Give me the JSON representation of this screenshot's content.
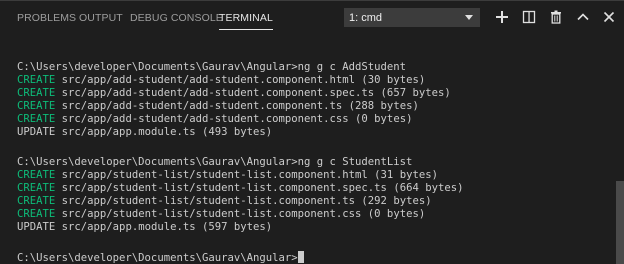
{
  "tabs": {
    "problems": "PROBLEMS",
    "output": "OUTPUT",
    "debug_console": "DEBUG CONSOLE",
    "terminal": "TERMINAL",
    "active": "TERMINAL"
  },
  "terminal_selector": {
    "selected": "1: cmd"
  },
  "actions": [
    {
      "name": "new-terminal",
      "icon": "plus-icon"
    },
    {
      "name": "split-terminal",
      "icon": "split-icon"
    },
    {
      "name": "kill-terminal",
      "icon": "trash-icon"
    },
    {
      "name": "maximize-panel",
      "icon": "chevron-up-icon"
    },
    {
      "name": "close-panel",
      "icon": "close-icon"
    }
  ],
  "terminal": {
    "lines": [
      {
        "prefix": "",
        "text": "C:\\Users\\developer\\Documents\\Gaurav\\Angular>ng g c AddStudent"
      },
      {
        "prefix": "CREATE",
        "text": " src/app/add-student/add-student.component.html (30 bytes)"
      },
      {
        "prefix": "CREATE",
        "text": " src/app/add-student/add-student.component.spec.ts (657 bytes)"
      },
      {
        "prefix": "CREATE",
        "text": " src/app/add-student/add-student.component.ts (288 bytes)"
      },
      {
        "prefix": "CREATE",
        "text": " src/app/add-student/add-student.component.css (0 bytes)"
      },
      {
        "prefix": "UPDATE",
        "text": " src/app/app.module.ts (493 bytes)"
      },
      {
        "prefix": "",
        "text": "C:\\Users\\developer\\Documents\\Gaurav\\Angular>ng g c StudentList"
      },
      {
        "prefix": "CREATE",
        "text": " src/app/student-list/student-list.component.html (31 bytes)"
      },
      {
        "prefix": "CREATE",
        "text": " src/app/student-list/student-list.component.spec.ts (664 bytes)"
      },
      {
        "prefix": "CREATE",
        "text": " src/app/student-list/student-list.component.ts (292 bytes)"
      },
      {
        "prefix": "CREATE",
        "text": " src/app/student-list/student-list.component.css (0 bytes)"
      },
      {
        "prefix": "UPDATE",
        "text": " src/app/app.module.ts (597 bytes)"
      },
      {
        "prefix": "",
        "text": "C:\\Users\\developer\\Documents\\Gaurav\\Angular>"
      }
    ]
  },
  "colors": {
    "background": "#1e1e1e",
    "create": "#0dbc79",
    "text": "#cccccc",
    "tab_active": "#e7e7e7",
    "tab_inactive": "#9d9d9d"
  }
}
